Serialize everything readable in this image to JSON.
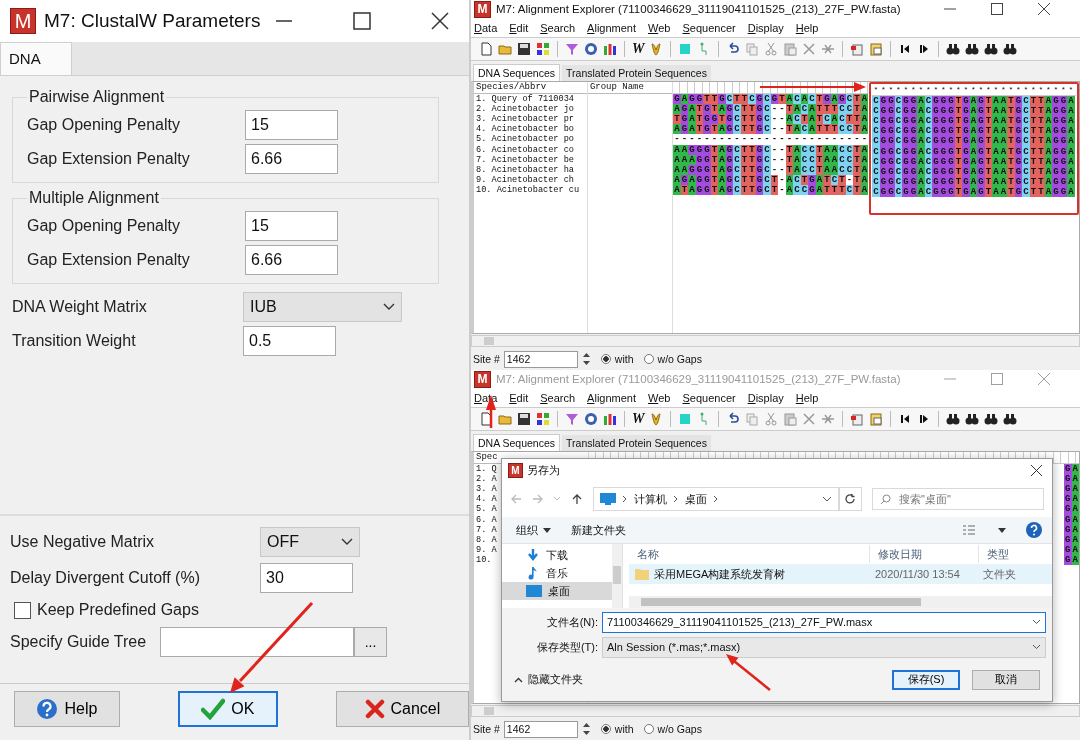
{
  "clustal_dialog": {
    "icon": "M",
    "title": "M7: ClustalW Parameters",
    "tabs": [
      {
        "label": "DNA",
        "selected": true
      }
    ],
    "groups": [
      {
        "title": "Pairwise Alignment",
        "rows": [
          {
            "label": "Gap Opening Penalty",
            "value": "15"
          },
          {
            "label": "Gap Extension Penalty",
            "value": "6.66"
          }
        ]
      },
      {
        "title": "Multiple Alignment",
        "rows": [
          {
            "label": "Gap Opening Penalty",
            "value": "15"
          },
          {
            "label": "Gap Extension Penalty",
            "value": "6.66"
          }
        ]
      }
    ],
    "settings": [
      {
        "kind": "dropdown",
        "label": "DNA Weight Matrix",
        "value": "IUB"
      },
      {
        "kind": "field",
        "label": "Transition Weight",
        "value": "0.5"
      }
    ],
    "options": [
      {
        "kind": "dropdown",
        "label": "Use Negative Matrix",
        "value": "OFF"
      },
      {
        "kind": "field",
        "label": "Delay Divergent Cutoff (%)",
        "value": "30"
      },
      {
        "kind": "checkbox",
        "label": "Keep Predefined Gaps",
        "checked": false
      },
      {
        "kind": "browse",
        "label": "Specify Guide Tree",
        "button": "..."
      }
    ],
    "buttons": [
      {
        "kind": "help",
        "label": "Help",
        "focused": false
      },
      {
        "kind": "ok",
        "label": "OK",
        "focused": true
      },
      {
        "kind": "cancel",
        "label": "Cancel",
        "focused": false
      }
    ]
  },
  "explorer_top": {
    "icon": "M",
    "title": "M7: Alignment Explorer (71100346629_31119041101525_(213)_27F_PW.fasta)",
    "active": true,
    "menu": [
      "Data",
      "Edit",
      "Search",
      "Alignment",
      "Web",
      "Sequencer",
      "Display",
      "Help"
    ],
    "toolbar_letter": "W",
    "tabs": [
      {
        "label": "DNA Sequences",
        "selected": true
      },
      {
        "label": "Translated Protein Sequences",
        "selected": false
      }
    ],
    "columns": [
      "Species/Abbrv",
      "Group Name"
    ],
    "consensus": "***************************",
    "rows": [
      {
        "name": "1. Query of 7110034",
        "sequence": "GAGGTTGCTTCGCGTACACTGAGCTA",
        "highlighted_sequence": "CGGCGGACGGGTGAGTAATGCTTAGGA"
      },
      {
        "name": "2. Acinetobacter jo",
        "sequence": "AGATGTAGCTTGC--TACATTTCCTA",
        "highlighted_sequence": "CGGCGGACGGGTGAGTAATGCTTAGGA"
      },
      {
        "name": "3. Acinetobacter pr",
        "sequence": "TGATGGTGCTTGC--ACTATCACTTA",
        "highlighted_sequence": "CGGCGGACGGGTGAGTAATGCTTAGGA"
      },
      {
        "name": "4. Acinetobacter bo",
        "sequence": "AGATGTAGCTTGC--TACATTTCCTA",
        "highlighted_sequence": "CGGCGGACGGGTGAGTAATGCTTAGGA"
      },
      {
        "name": "5. Acinetobacter po",
        "sequence": "--------------------------",
        "highlighted_sequence": "CGGCGGACGGGTGAGTAATGCTTAGGA"
      },
      {
        "name": "6. Acinetobacter co",
        "sequence": "AAGGGTAGCTTGC--TACCTAACCTA",
        "highlighted_sequence": "CGGCGGACGGGTGAGTAATGCTTAGGA"
      },
      {
        "name": "7. Acinetobacter be",
        "sequence": "AAAGGTAGCTTGC--TACCTAACCTA",
        "highlighted_sequence": "CGGCGGACGGGTGAGTAATGCTTAGGA"
      },
      {
        "name": "8. Acinetobacter ha",
        "sequence": "AAGGGTAGCTTGC--TACCTAACCTA",
        "highlighted_sequence": "CGGCGGACGGGTGAGTAATGCTTAGGA"
      },
      {
        "name": "9. Acinetobacter ch",
        "sequence": "AGAGGTAGCTTGCT-ACTGATCT-TA",
        "highlighted_sequence": "CGGCGGACGGGTGAGTAATGCTTAGGA"
      },
      {
        "name": "10. Acinetobacter cu",
        "sequence": "ATAGGTAGCTTGCT-ACCGATTTCTA",
        "highlighted_sequence": "CGGCGGACGGGTGAGTAATGCTTAGGA"
      }
    ],
    "site_label": "Site #",
    "site": "1462",
    "radios": [
      {
        "label": "with",
        "selected": true
      },
      {
        "label": "w/o Gaps",
        "selected": false
      }
    ]
  },
  "explorer_bottom": {
    "icon": "M",
    "title": "M7: Alignment Explorer (71100346629_31119041101525_(213)_27F_PW.fasta)",
    "active": false,
    "menu": [
      "Data",
      "Edit",
      "Search",
      "Alignment",
      "Web",
      "Sequencer",
      "Display",
      "Help"
    ],
    "toolbar_letter": "W",
    "tabs": [
      {
        "label": "DNA Sequences",
        "selected": true
      },
      {
        "label": "Translated Protein Sequences",
        "selected": false
      }
    ],
    "columns": [
      "Spec"
    ],
    "rows": [
      {
        "name": "1. Q",
        "sequence": "GA"
      },
      {
        "name": "2. A",
        "sequence": "GA"
      },
      {
        "name": "3. A",
        "sequence": "GA"
      },
      {
        "name": "4. A",
        "sequence": "GA"
      },
      {
        "name": "5. A",
        "sequence": "GA"
      },
      {
        "name": "6. A",
        "sequence": "GA"
      },
      {
        "name": "7. A",
        "sequence": "GA"
      },
      {
        "name": "8. A",
        "sequence": "GA"
      },
      {
        "name": "9. A",
        "sequence": "GA"
      },
      {
        "name": "10.",
        "sequence": "GA"
      }
    ],
    "site_label": "Site #",
    "site": "1462",
    "radios": [
      {
        "label": "with",
        "selected": true
      },
      {
        "label": "w/o Gaps",
        "selected": false
      }
    ],
    "dialog": {
      "icon": "M",
      "title": "另存为",
      "path": [
        "计算机",
        "桌面"
      ],
      "search": {
        "placeholder": "搜索\"桌面\""
      },
      "commands": [
        "组织",
        "新建文件夹"
      ],
      "nav": [
        {
          "kind": "download",
          "label": "下载",
          "selected": false
        },
        {
          "kind": "music",
          "label": "音乐",
          "selected": false
        },
        {
          "kind": "desktop",
          "label": "桌面",
          "selected": true
        }
      ],
      "columns": [
        "名称",
        "修改日期",
        "类型"
      ],
      "files": [
        {
          "name": "采用MEGA构建系统发育树",
          "modified": "2020/11/30 13:54",
          "type": "文件夹",
          "selected": true
        }
      ],
      "filename_label": "文件名(N):",
      "filename": "71100346629_31119041101525_(213)_27F_PW.masx",
      "type_label": "保存类型(T):",
      "type": "Aln Session (*.mas;*.masx)",
      "hide_folders": "隐藏文件夹",
      "buttons": [
        {
          "label": "保存(S)",
          "focused": true
        },
        {
          "label": "取消",
          "focused": false
        }
      ]
    }
  }
}
